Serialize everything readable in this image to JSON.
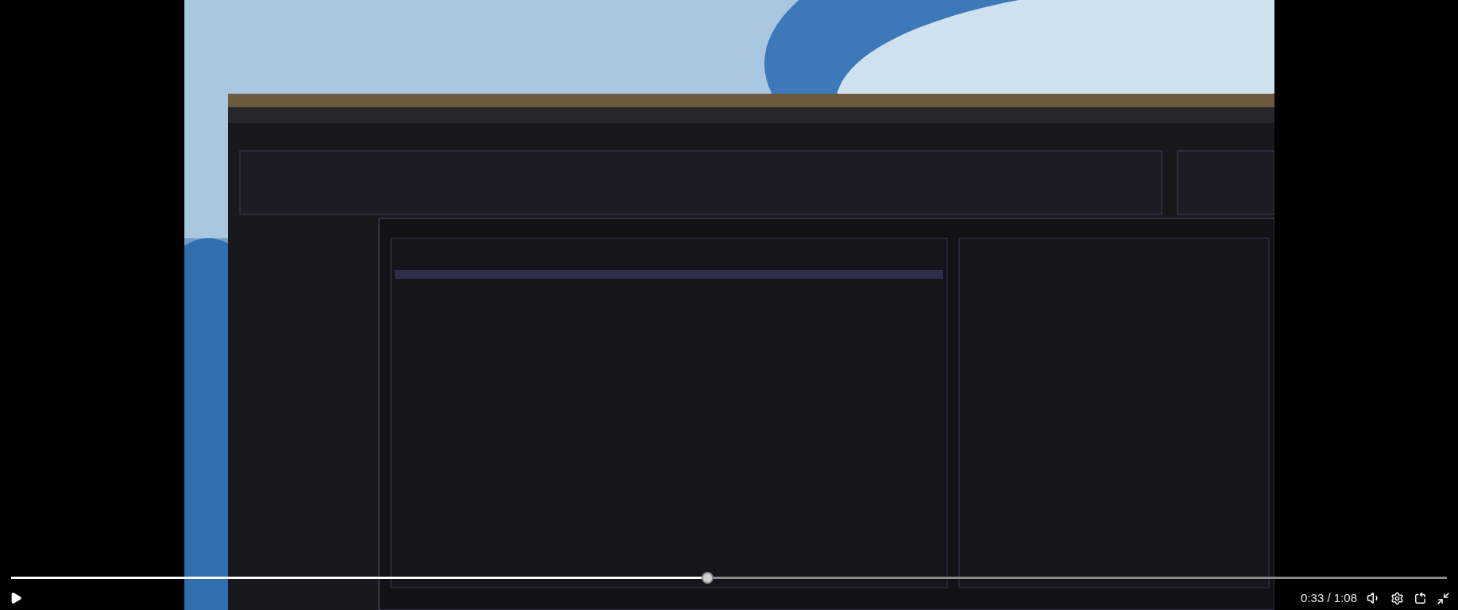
{
  "player": {
    "playing": false,
    "progress": {
      "level": 0.485
    },
    "time": "0:33 / 1:08"
  }
}
